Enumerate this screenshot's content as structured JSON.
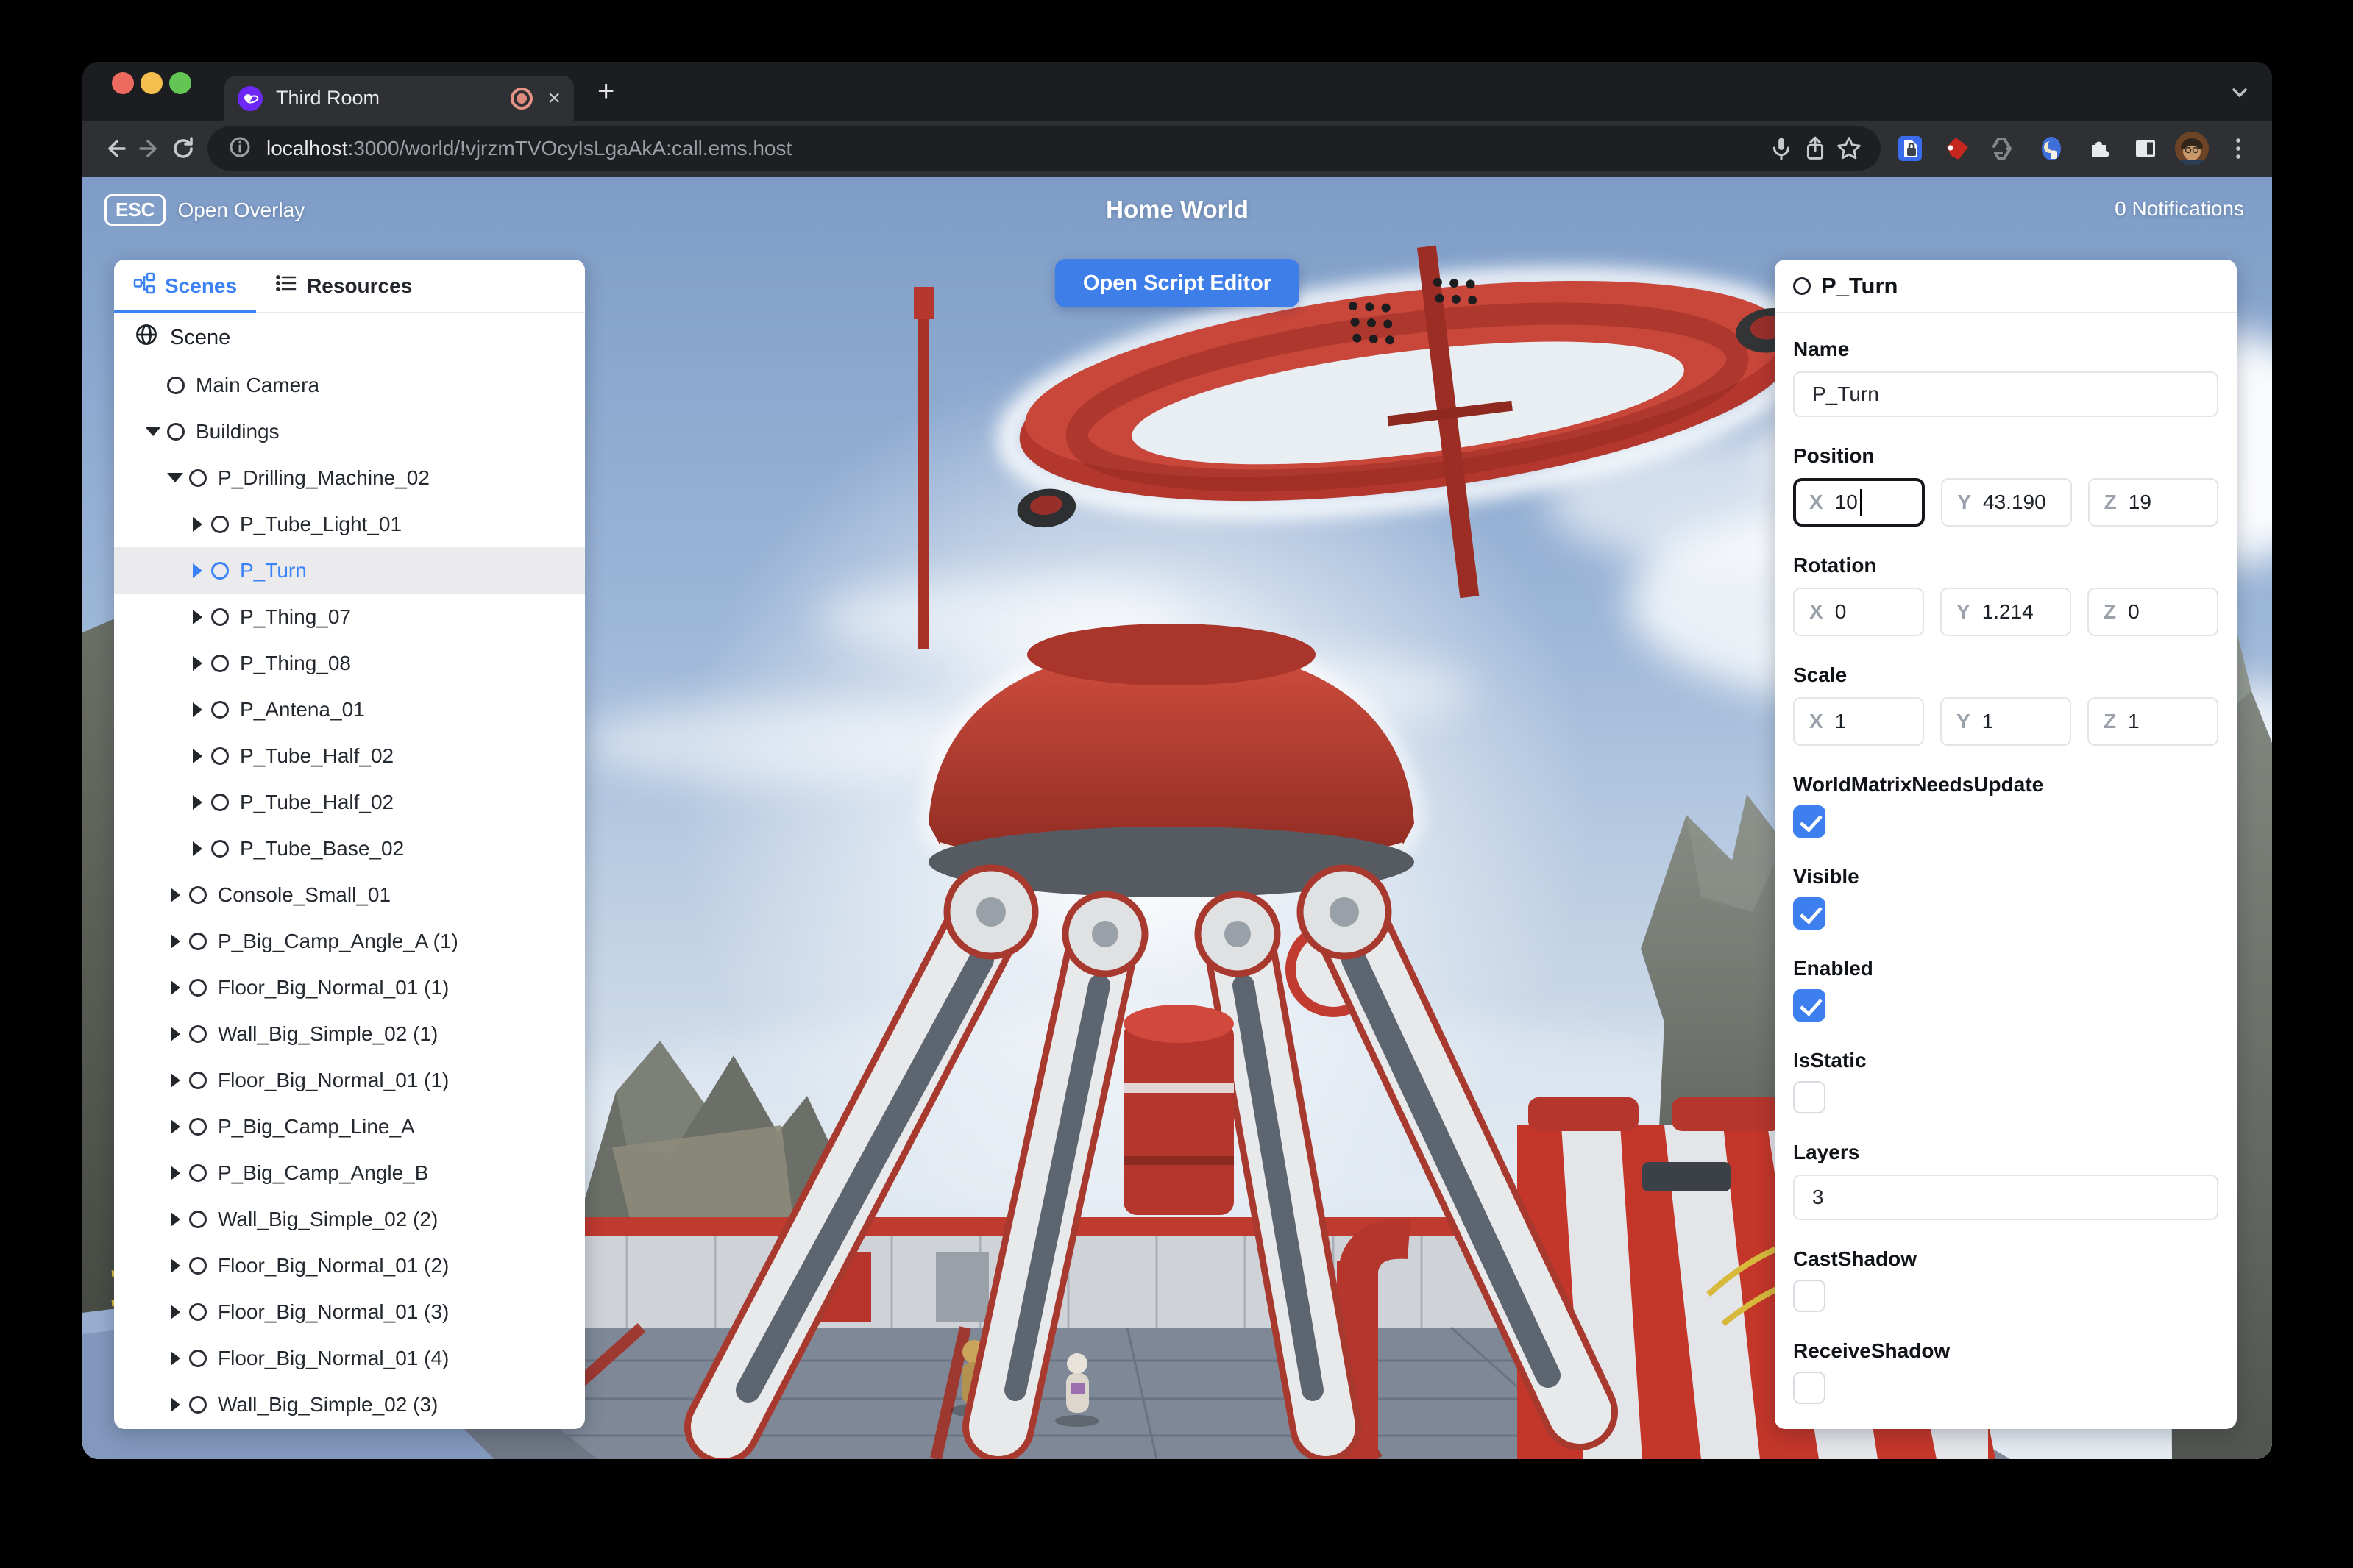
{
  "browser": {
    "tab_title": "Third Room",
    "url_host": "localhost",
    "url_rest": ":3000/world/!vjrzmTVOcyIsLgaAkA:call.ems.host",
    "new_tab_glyph": "+",
    "close_tab_glyph": "×",
    "icons": {
      "window_controls": [
        "close-button",
        "minimize-button",
        "zoom-button"
      ],
      "tab": [
        "third-room-favicon",
        "recording-indicator-icon",
        "close-tab-icon",
        "new-tab-icon",
        "tab-strip-chevron-icon"
      ],
      "toolbar": [
        "back-icon",
        "forward-icon",
        "reload-icon",
        "site-info-icon",
        "mic-icon",
        "share-icon",
        "bookmark-star-icon",
        "password-extension-icon",
        "red-extension-icon",
        "recycle-extension-icon",
        "moon-extension-icon",
        "extensions-puzzle-icon",
        "sidebar-icon",
        "profile-avatar",
        "menu-kebab-icon"
      ]
    }
  },
  "hud": {
    "esc_key": "ESC",
    "open_overlay_label": "Open Overlay",
    "world_title": "Home World",
    "notifications_label": "0 Notifications",
    "open_script_editor_label": "Open Script Editor"
  },
  "scene_panel": {
    "tabs": [
      {
        "label": "Scenes",
        "icon": "hierarchy-icon",
        "active": true
      },
      {
        "label": "Resources",
        "icon": "list-icon",
        "active": false
      }
    ],
    "root_label": "Scene",
    "tree": [
      {
        "label": "Main Camera",
        "depth": 1,
        "expand": null,
        "selected": false
      },
      {
        "label": "Buildings",
        "depth": 1,
        "expand": "down",
        "selected": false
      },
      {
        "label": "P_Drilling_Machine_02",
        "depth": 2,
        "expand": "down",
        "selected": false
      },
      {
        "label": "P_Tube_Light_01",
        "depth": 3,
        "expand": "right",
        "selected": false
      },
      {
        "label": "P_Turn",
        "depth": 3,
        "expand": "right",
        "selected": true
      },
      {
        "label": "P_Thing_07",
        "depth": 3,
        "expand": "right",
        "selected": false
      },
      {
        "label": "P_Thing_08",
        "depth": 3,
        "expand": "right",
        "selected": false
      },
      {
        "label": "P_Antena_01",
        "depth": 3,
        "expand": "right",
        "selected": false
      },
      {
        "label": "P_Tube_Half_02",
        "depth": 3,
        "expand": "right",
        "selected": false
      },
      {
        "label": "P_Tube_Half_02",
        "depth": 3,
        "expand": "right",
        "selected": false
      },
      {
        "label": "P_Tube_Base_02",
        "depth": 3,
        "expand": "right",
        "selected": false
      },
      {
        "label": "Console_Small_01",
        "depth": 2,
        "expand": "right",
        "selected": false
      },
      {
        "label": "P_Big_Camp_Angle_A (1)",
        "depth": 2,
        "expand": "right",
        "selected": false
      },
      {
        "label": "Floor_Big_Normal_01 (1)",
        "depth": 2,
        "expand": "right",
        "selected": false
      },
      {
        "label": "Wall_Big_Simple_02 (1)",
        "depth": 2,
        "expand": "right",
        "selected": false
      },
      {
        "label": "Floor_Big_Normal_01 (1)",
        "depth": 2,
        "expand": "right",
        "selected": false
      },
      {
        "label": "P_Big_Camp_Line_A",
        "depth": 2,
        "expand": "right",
        "selected": false
      },
      {
        "label": "P_Big_Camp_Angle_B",
        "depth": 2,
        "expand": "right",
        "selected": false
      },
      {
        "label": "Wall_Big_Simple_02 (2)",
        "depth": 2,
        "expand": "right",
        "selected": false
      },
      {
        "label": "Floor_Big_Normal_01 (2)",
        "depth": 2,
        "expand": "right",
        "selected": false
      },
      {
        "label": "Floor_Big_Normal_01 (3)",
        "depth": 2,
        "expand": "right",
        "selected": false
      },
      {
        "label": "Floor_Big_Normal_01 (4)",
        "depth": 2,
        "expand": "right",
        "selected": false
      },
      {
        "label": "Wall_Big_Simple_02 (3)",
        "depth": 2,
        "expand": "right",
        "selected": false
      }
    ]
  },
  "inspector": {
    "title": "P_Turn",
    "axis": {
      "x": "X",
      "y": "Y",
      "z": "Z"
    },
    "fields": {
      "name": {
        "label": "Name",
        "value": "P_Turn"
      },
      "position": {
        "label": "Position",
        "x": "10",
        "y": "43.190",
        "z": "19",
        "focused_axis": "x"
      },
      "rotation": {
        "label": "Rotation",
        "x": "0",
        "y": "1.214",
        "z": "0"
      },
      "scale": {
        "label": "Scale",
        "x": "1",
        "y": "1",
        "z": "1"
      },
      "world_matrix": {
        "label": "WorldMatrixNeedsUpdate",
        "checked": true
      },
      "visible": {
        "label": "Visible",
        "checked": true
      },
      "enabled": {
        "label": "Enabled",
        "checked": true
      },
      "is_static": {
        "label": "IsStatic",
        "checked": false
      },
      "layers": {
        "label": "Layers",
        "value": "3"
      },
      "cast_shadow": {
        "label": "CastShadow",
        "checked": false
      },
      "receive_shadow": {
        "label": "ReceiveShadow",
        "checked": false
      }
    }
  },
  "colors": {
    "accent_blue": "#3b82f6",
    "button_blue": "#3e7ee9",
    "checkbox_blue": "#3d7fee",
    "selection_red": "#b4372d",
    "record_red": "#e59287",
    "favicon_purple": "#6d28f5"
  }
}
